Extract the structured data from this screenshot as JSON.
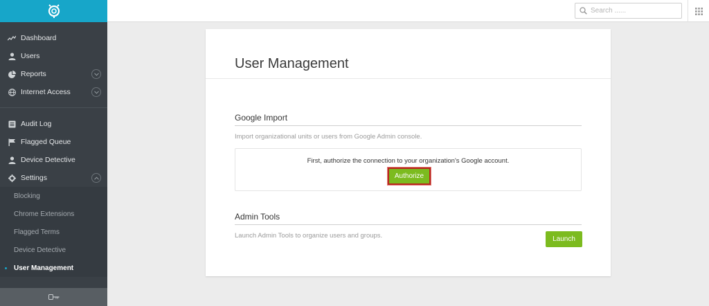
{
  "sidebar": {
    "main_items": [
      {
        "label": "Dashboard",
        "icon": "activity-icon"
      },
      {
        "label": "Users",
        "icon": "user-icon"
      },
      {
        "label": "Reports",
        "icon": "pie-chart-icon",
        "expandable": true
      },
      {
        "label": "Internet Access",
        "icon": "globe-icon",
        "expandable": true
      }
    ],
    "secondary_items": [
      {
        "label": "Audit Log",
        "icon": "list-icon"
      },
      {
        "label": "Flagged Queue",
        "icon": "flag-icon"
      },
      {
        "label": "Device Detective",
        "icon": "user-icon"
      },
      {
        "label": "Settings",
        "icon": "gear-icon",
        "expanded": true
      }
    ],
    "settings_sub_items": [
      {
        "label": "Blocking"
      },
      {
        "label": "Chrome Extensions"
      },
      {
        "label": "Flagged Terms"
      },
      {
        "label": "Device Detective"
      },
      {
        "label": "User Management",
        "active": true
      }
    ]
  },
  "topbar": {
    "search_placeholder": "Search ......"
  },
  "main": {
    "title": "User Management",
    "google_import": {
      "title": "Google Import",
      "description": "Import organizational units or users from Google Admin console.",
      "authorize_text": "First, authorize the connection to your organization's Google account.",
      "authorize_button": "Authorize"
    },
    "admin_tools": {
      "title": "Admin Tools",
      "description": "Launch Admin Tools to organize users and groups.",
      "launch_button": "Launch"
    }
  },
  "colors": {
    "brand": "#17a6c9",
    "sidebar": "#3a4046",
    "button_green": "#7cbb1f",
    "highlight_red": "#b9261f"
  }
}
